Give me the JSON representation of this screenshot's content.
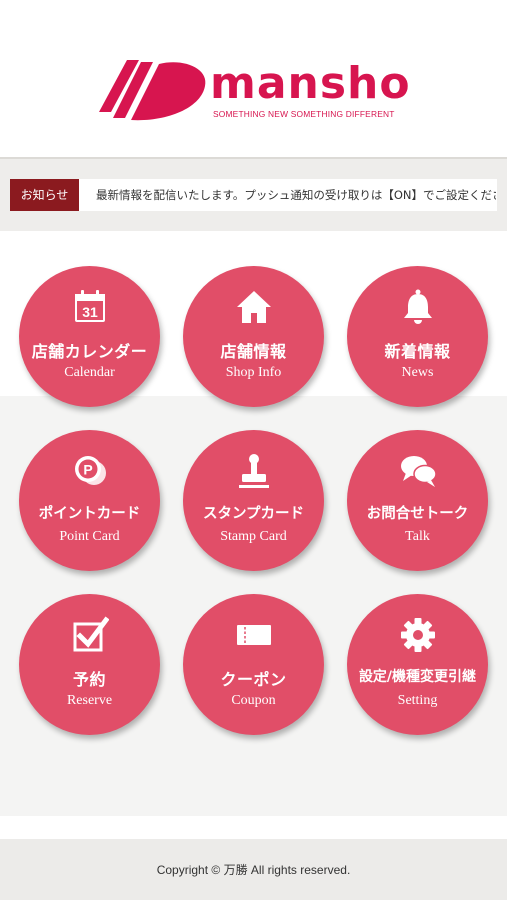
{
  "header": {
    "logo_text": "mansho",
    "tagline": "SOMETHING NEW SOMETHING DIFFERENT",
    "brand_color": "#d7154f"
  },
  "notice": {
    "badge": "お知らせ",
    "text": "最新情報を配信いたします。プッシュ通知の受け取りは【ON】でご設定ください。"
  },
  "menu": {
    "accent_color": "#e14e68",
    "items": [
      {
        "jp": "店舗カレンダー",
        "en": "Calendar",
        "icon": "calendar-icon",
        "icon_text": "31"
      },
      {
        "jp": "店舗情報",
        "en": "Shop Info",
        "icon": "house-icon"
      },
      {
        "jp": "新着情報",
        "en": "News",
        "icon": "bell-icon"
      },
      {
        "jp": "ポイントカード",
        "en": "Point Card",
        "icon": "point-coin-icon",
        "icon_text": "P"
      },
      {
        "jp": "スタンプカード",
        "en": "Stamp Card",
        "icon": "stamp-icon"
      },
      {
        "jp": "お問合せトーク",
        "en": "Talk",
        "icon": "chat-bubbles-icon"
      },
      {
        "jp": "予約",
        "en": "Reserve",
        "icon": "checkbox-icon"
      },
      {
        "jp": "クーポン",
        "en": "Coupon",
        "icon": "ticket-icon"
      },
      {
        "jp": "設定/機種変更引継",
        "en": "Setting",
        "icon": "gear-icon"
      }
    ]
  },
  "footer": {
    "copyright": "Copyright © 万勝 All rights reserved."
  }
}
